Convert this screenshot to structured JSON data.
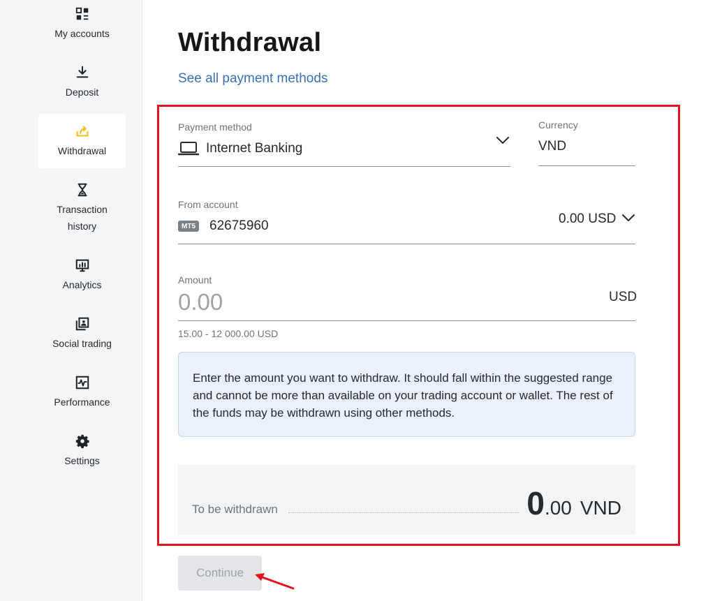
{
  "sidebar": {
    "items": [
      {
        "label": "My accounts",
        "icon": "grid-icon"
      },
      {
        "label": "Deposit",
        "icon": "download-icon"
      },
      {
        "label": "Withdrawal",
        "icon": "withdraw-icon",
        "active": true
      },
      {
        "label": "Transaction history",
        "icon": "hourglass-icon"
      },
      {
        "label": "Analytics",
        "icon": "analytics-icon"
      },
      {
        "label": "Social trading",
        "icon": "social-trading-icon"
      },
      {
        "label": "Performance",
        "icon": "performance-icon"
      },
      {
        "label": "Settings",
        "icon": "gear-icon"
      }
    ]
  },
  "main": {
    "title": "Withdrawal",
    "see_all_link": "See all payment methods"
  },
  "form": {
    "payment_method": {
      "label": "Payment method",
      "value": "Internet Banking"
    },
    "currency": {
      "label": "Currency",
      "value": "VND"
    },
    "from_account": {
      "label": "From account",
      "badge": "MT5",
      "number": "62675960",
      "balance": "0.00 USD"
    },
    "amount": {
      "label": "Amount",
      "placeholder": "0.00",
      "unit": "USD",
      "range": "15.00 - 12 000.00 USD"
    },
    "info_text": "Enter the amount you want to withdraw. It should fall within the suggested range and cannot be more than available on your trading account or wallet. The rest of the funds may be withdrawn using other methods.",
    "to_be_withdrawn": {
      "label": "To be withdrawn",
      "integer": "0",
      "decimal": ".00",
      "currency": "VND"
    },
    "continue_label": "Continue"
  },
  "colors": {
    "accent_link": "#3b6fb6",
    "highlight": "#e0141c",
    "active_icon": "#f2c21b",
    "info_bg": "#eaf1fd"
  }
}
